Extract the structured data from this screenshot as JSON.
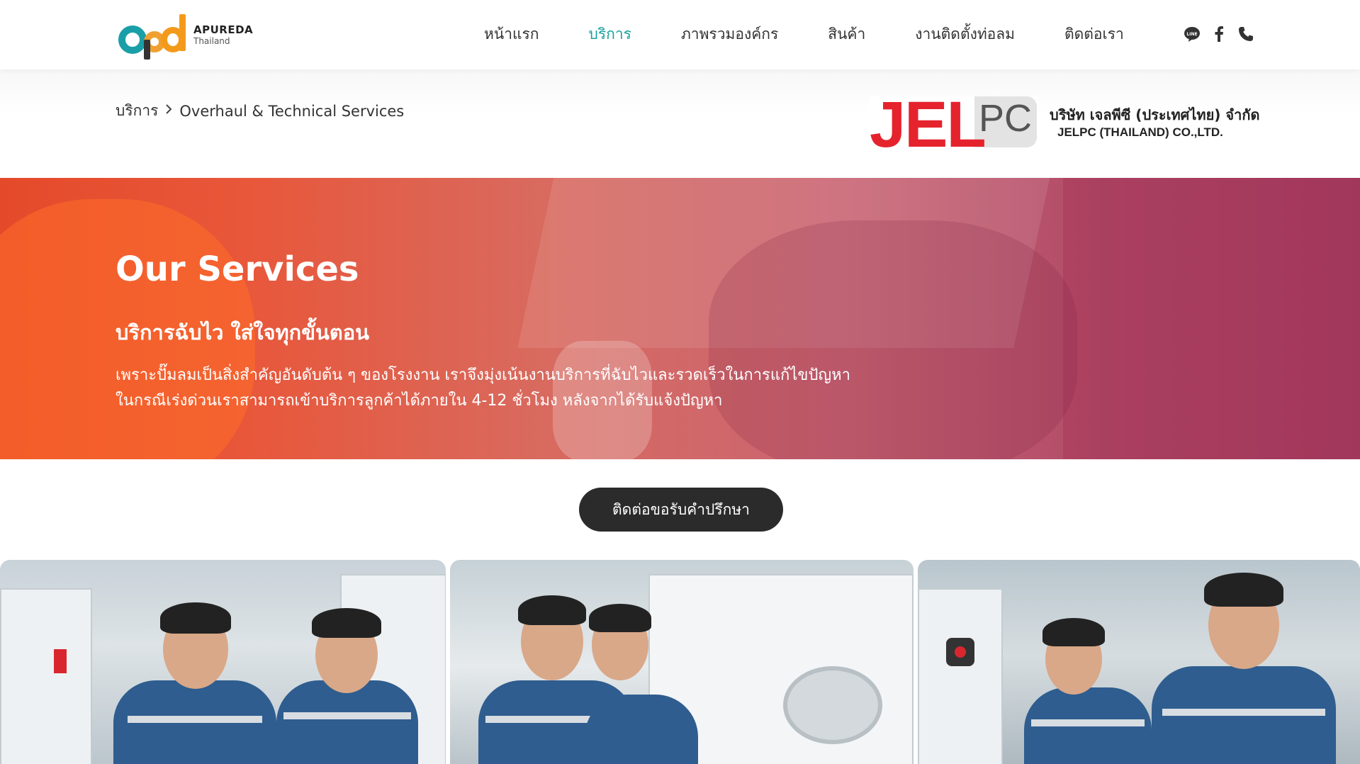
{
  "header": {
    "logo": {
      "name": "APUREDA",
      "sub": "Thailand"
    },
    "nav": [
      {
        "label": "หน้าแรก",
        "active": false
      },
      {
        "label": "บริการ",
        "active": true
      },
      {
        "label": "ภาพรวมองค์กร",
        "active": false
      },
      {
        "label": "สินค้า",
        "active": false
      },
      {
        "label": "งานติดตั้งท่อลม",
        "active": false
      },
      {
        "label": "ติดต่อเรา",
        "active": false
      }
    ],
    "social_icons": [
      "line-icon",
      "facebook-icon",
      "phone-icon"
    ],
    "active_color": "#17a2a0"
  },
  "breadcrumb": {
    "parent": "บริการ",
    "current": "Overhaul & Technical Services"
  },
  "partner": {
    "logo_jel": "JEL",
    "logo_pc": "PC",
    "name_th": "บริษัท เจลพีซี (ประเทศไทย) จำกัด",
    "name_en": "JELPC (THAILAND) CO.,LTD.",
    "brand_color": "#e5232d"
  },
  "hero": {
    "title": "Our Services",
    "subtitle": "บริการฉับไว ใส่ใจทุกขั้นตอน",
    "desc_line1": "เพราะปั๊มลมเป็นสิ่งสำคัญอันดับต้น ๆ ของโรงงาน เราจึงมุ่งเน้นงานบริการที่ฉับไวและรวดเร็วในการแก้ไขปัญหา",
    "desc_line2": "ในกรณีเร่งด่วนเราสามารถเข้าบริการลูกค้าได้ภายใน 4-12 ชั่วโมง หลังจากได้รับแจ้งปัญหา"
  },
  "cta": {
    "label": "ติดต่อขอรับคำปรึกษา",
    "color": "#2b2b2b"
  }
}
